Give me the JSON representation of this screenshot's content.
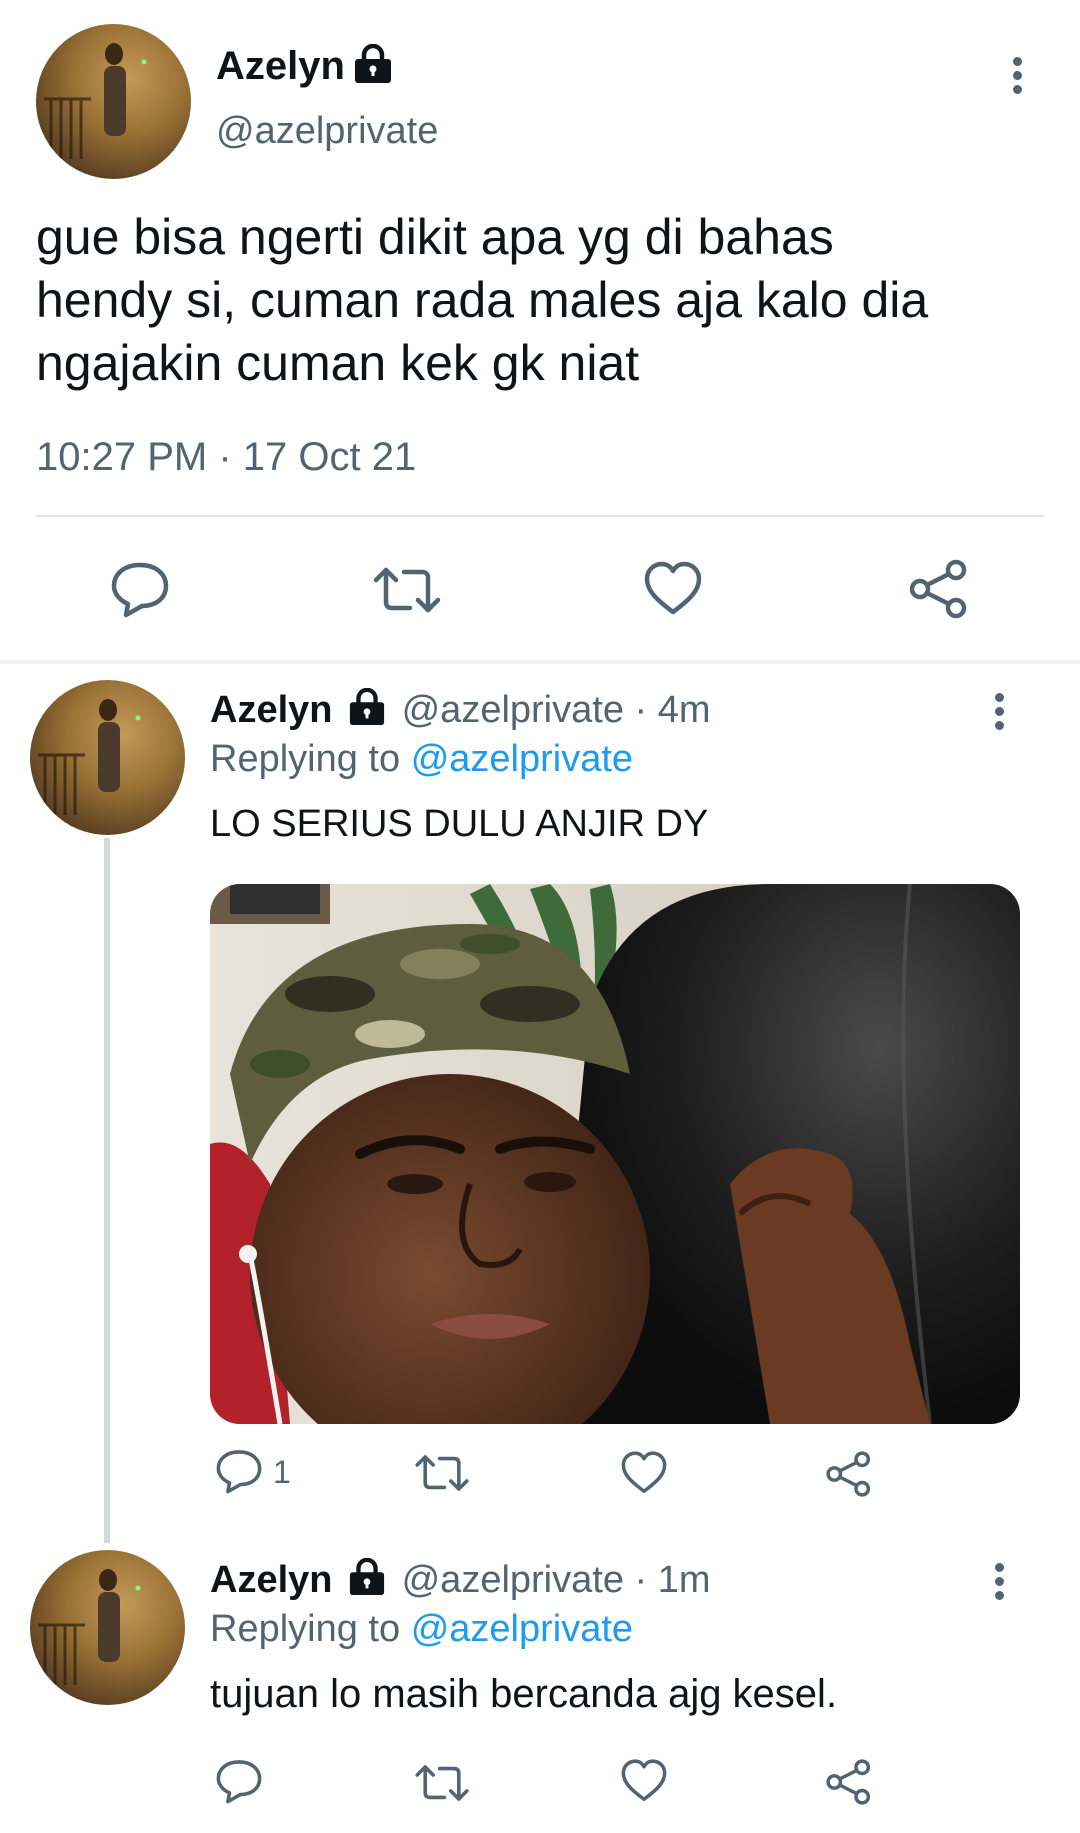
{
  "main_tweet": {
    "display_name": "Azelyn",
    "handle": "@azelprivate",
    "text_lines": [
      "gue bisa ngerti dikit apa yg di bahas",
      "hendy si, cuman rada males aja kalo dia",
      "ngajakin cuman kek gk niat"
    ],
    "timestamp": "10:27 PM · 17 Oct 21"
  },
  "replies": [
    {
      "display_name": "Azelyn",
      "handle": "@azelprivate",
      "time": "· 4m",
      "replying_prefix": "Replying to",
      "replying_to": "@azelprivate",
      "text": "LO SERIUS DULU ANJIR DY",
      "reply_count": "1"
    },
    {
      "display_name": "Azelyn",
      "handle": "@azelprivate",
      "time": "· 1m",
      "replying_prefix": "Replying to",
      "replying_to": "@azelprivate",
      "text": "tujuan lo masih bercanda ajg kesel."
    }
  ],
  "icons": {
    "reply": "reply-icon",
    "retweet": "retweet-icon",
    "like": "like-icon",
    "share": "share-icon",
    "more": "more-options-icon",
    "lock": "lock-icon"
  },
  "colors": {
    "link": "#1d9bf0",
    "muted": "#536471",
    "text": "#0f1419",
    "divider": "#e1e8ed"
  }
}
